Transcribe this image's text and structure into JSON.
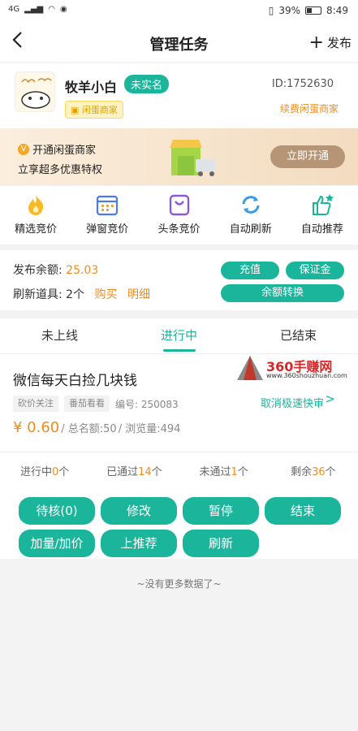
{
  "status_bar": {
    "network_left": "4G",
    "battery": "39%",
    "time": "8:49"
  },
  "header": {
    "title": "管理任务",
    "publish_label": "发布",
    "publish_plus": "+"
  },
  "profile": {
    "name": "牧羊小白",
    "verify_status": "未实名",
    "merchant_tag": "闲蛋商家",
    "id_label": "ID:1752630",
    "renew_link": "续费闲蛋商家"
  },
  "banner": {
    "line1": "开通闲蛋商家",
    "line2": "立享超多优惠特权",
    "cta": "立即开通",
    "badge": "V"
  },
  "quick_actions": [
    {
      "label": "精选竞价",
      "icon": "flame-icon"
    },
    {
      "label": "弹窗竞价",
      "icon": "calendar-icon"
    },
    {
      "label": "头条竞价",
      "icon": "shopping-bag-icon"
    },
    {
      "label": "自动刷新",
      "icon": "refresh-icon"
    },
    {
      "label": "自动推荐",
      "icon": "thumbs-up-star-icon"
    }
  ],
  "balance": {
    "label": "发布余额:",
    "amount": "25.03",
    "props_label": "刷新道具:",
    "props_count": "2个",
    "buy_link": "购买",
    "detail_link": "明细",
    "recharge": "充值",
    "deposit": "保证金",
    "convert": "余额转换"
  },
  "tabs": [
    {
      "label": "未上线",
      "active": false
    },
    {
      "label": "进行中",
      "active": true
    },
    {
      "label": "已结束",
      "active": false
    }
  ],
  "watermark": {
    "text": "360手赚网",
    "url": "www.360shouzhuan.com"
  },
  "task": {
    "title": "微信每天白捡几块钱",
    "tag1": "砍价关注",
    "tag2": "番茄看看",
    "serial": "编号: 250083",
    "cancel_link": "取消极速快审",
    "chevron": ">",
    "price": "¥ 0.60",
    "quota": "/ 总名额:50",
    "views": "/ 浏览量:494",
    "stats": [
      {
        "prefix": "进行中",
        "num": "0",
        "suffix": "个"
      },
      {
        "prefix": "已通过",
        "num": "14",
        "suffix": "个"
      },
      {
        "prefix": "未通过",
        "num": "1",
        "suffix": "个"
      },
      {
        "prefix": "剩余",
        "num": "36",
        "suffix": "个"
      }
    ],
    "buttons": [
      "待核(0)",
      "修改",
      "暂停",
      "结束",
      "加量/加价",
      "上推荐",
      "刷新"
    ]
  },
  "footer_text": "~没有更多数据了~",
  "colors": {
    "accent": "#1bb59b",
    "highlight": "#f08c1e"
  }
}
